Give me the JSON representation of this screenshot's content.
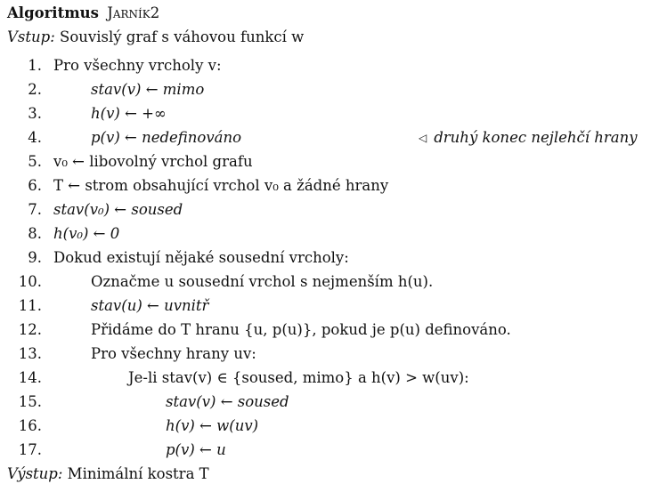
{
  "algorithm": {
    "title_keyword": "Algoritmus",
    "title_name": "Jarník2",
    "input_label": "Vstup:",
    "input_text": "Souvislý graf s váhovou funkcí w",
    "output_label": "Výstup:",
    "output_text": "Minimální kostra T",
    "lines": [
      {
        "num": "1.",
        "text": "Pro všechny vrcholy v:"
      },
      {
        "num": "2.",
        "text": "stav(v) ← mimo"
      },
      {
        "num": "3.",
        "text": "h(v) ← +∞"
      },
      {
        "num": "4.",
        "text": "p(v) ← nedefinováno",
        "comment": "druhý konec nejlehčí hrany"
      },
      {
        "num": "5.",
        "text": "v₀ ← libovolný vrchol grafu"
      },
      {
        "num": "6.",
        "text": "T ← strom obsahující vrchol v₀ a žádné hrany"
      },
      {
        "num": "7.",
        "text": "stav(v₀) ← soused"
      },
      {
        "num": "8.",
        "text": "h(v₀) ← 0"
      },
      {
        "num": "9.",
        "text": "Dokud existují nějaké sousední vrcholy:"
      },
      {
        "num": "10.",
        "text": "Označme u sousední vrchol s nejmenším h(u)."
      },
      {
        "num": "11.",
        "text": "stav(u) ← uvnitř"
      },
      {
        "num": "12.",
        "text": "Přidáme do T hranu {u, p(u)}, pokud je p(u) definováno."
      },
      {
        "num": "13.",
        "text": "Pro všechny hrany uv:"
      },
      {
        "num": "14.",
        "text": "Je-li stav(v) ∈ {soused, mimo} a h(v) > w(uv):"
      },
      {
        "num": "15.",
        "text": "stav(v) ← soused"
      },
      {
        "num": "16.",
        "text": "h(v) ← w(uv)"
      },
      {
        "num": "17.",
        "text": "p(v) ← u"
      }
    ]
  }
}
